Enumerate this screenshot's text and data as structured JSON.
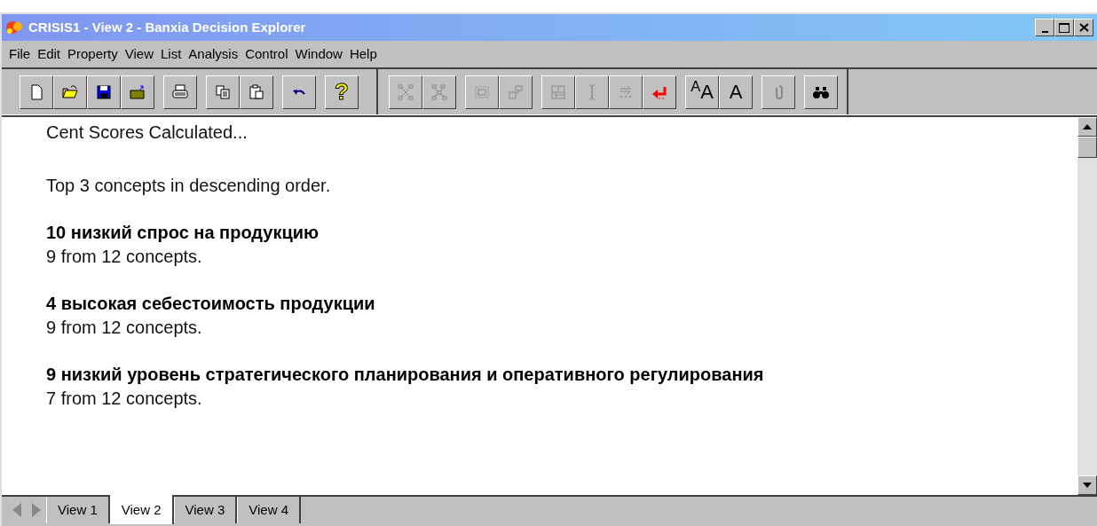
{
  "window": {
    "title": "CRISIS1 - View 2 - Banxia Decision Explorer"
  },
  "menu": [
    "File",
    "Edit",
    "Property",
    "View",
    "List",
    "Analysis",
    "Control",
    "Window",
    "Help"
  ],
  "toolbar": [
    [
      {
        "kind": "new",
        "disabled": false
      },
      {
        "kind": "open",
        "disabled": false
      },
      {
        "kind": "save",
        "disabled": false
      },
      {
        "kind": "folder-up",
        "disabled": false
      }
    ],
    [
      {
        "kind": "print",
        "disabled": false
      }
    ],
    [
      {
        "kind": "copy",
        "disabled": false
      },
      {
        "kind": "paste",
        "disabled": false
      }
    ],
    [
      {
        "kind": "undo",
        "disabled": false
      }
    ],
    [
      {
        "kind": "help",
        "label": "?",
        "disabled": false
      }
    ],
    [
      {
        "kind": "nodes",
        "disabled": true
      },
      {
        "kind": "network",
        "disabled": true
      }
    ],
    [
      {
        "kind": "frame",
        "disabled": true
      },
      {
        "kind": "steps",
        "disabled": true
      }
    ],
    [
      {
        "kind": "grid",
        "disabled": true
      },
      {
        "kind": "cursor",
        "disabled": true
      },
      {
        "kind": "arrows",
        "disabled": true
      },
      {
        "kind": "return",
        "disabled": false
      }
    ],
    [
      {
        "kind": "font",
        "label": "$^{A}$A",
        "disabled": false
      },
      {
        "kind": "font",
        "label": "A",
        "disabled": false
      }
    ],
    [
      {
        "kind": "clip",
        "disabled": true
      }
    ],
    [
      {
        "kind": "find",
        "disabled": false
      }
    ]
  ],
  "content": [
    {
      "kind": "text",
      "text": "Cent Scores Calculated..."
    },
    {
      "kind": "text",
      "text": "Top 3 concepts in descending order."
    },
    {
      "kind": "heading",
      "text": "10 низкий спрос на продукцию"
    },
    {
      "kind": "text",
      "text": "9 from 12 concepts."
    },
    {
      "kind": "heading",
      "text": "4 высокая себестоимость продукции"
    },
    {
      "kind": "text",
      "text": "9 from 12 concepts."
    },
    {
      "kind": "heading",
      "text": "9 низкий уровень стратегического планирования и оперативного регулирования"
    },
    {
      "kind": "text",
      "text": "7 from 12 concepts."
    }
  ],
  "tabs": [
    {
      "label": "View 1",
      "selected": false
    },
    {
      "label": "View 2",
      "selected": true
    },
    {
      "label": "View 3",
      "selected": false
    },
    {
      "label": "View 4",
      "selected": false
    }
  ]
}
